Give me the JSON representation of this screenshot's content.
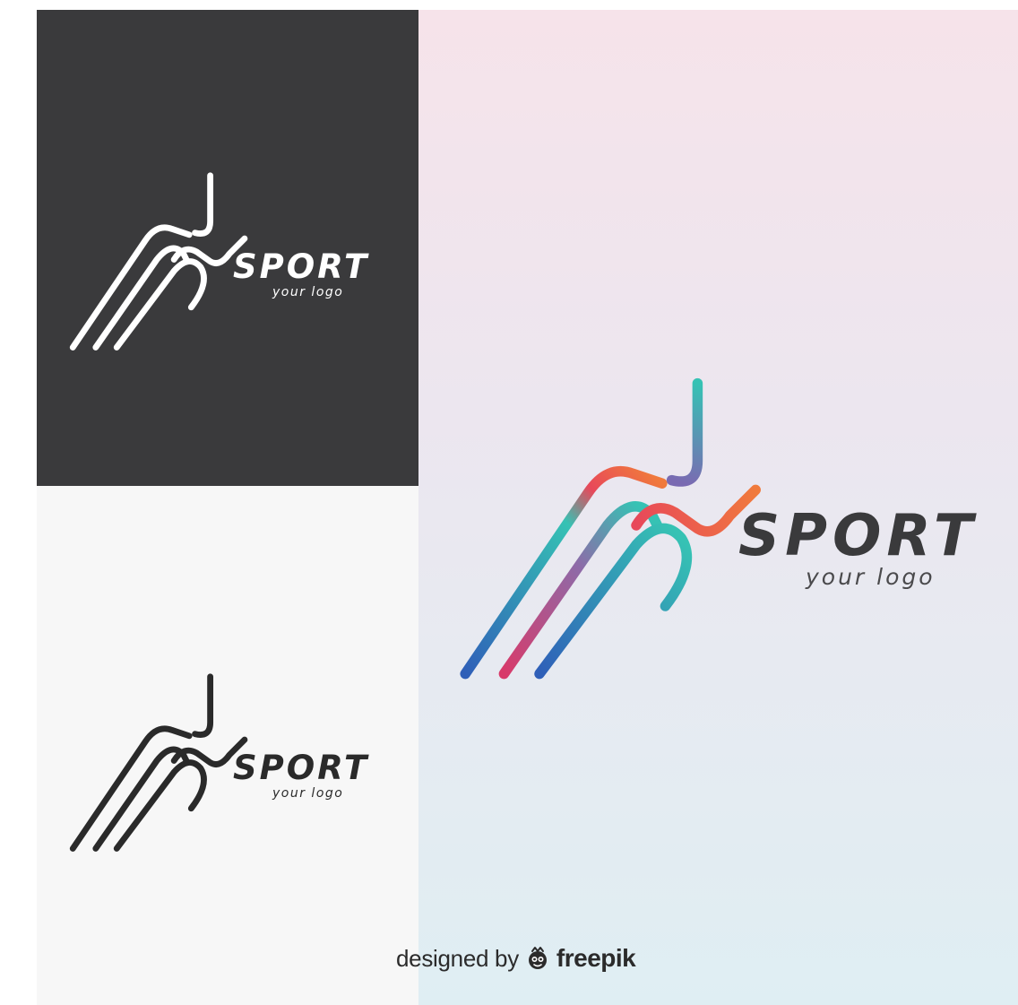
{
  "logos": [
    {
      "variant": "white-on-dark",
      "title": "SPORT",
      "tagline": "your logo",
      "color": "#ffffff"
    },
    {
      "variant": "black-on-light",
      "title": "SPORT",
      "tagline": "your logo",
      "color": "#2a2a2a"
    },
    {
      "variant": "gradient",
      "title": "SPORT",
      "tagline": "your logo",
      "color": "#3a3a3c"
    }
  ],
  "colors": {
    "dark_panel": "#3a3a3c",
    "light_panel": "#f7f7f7",
    "gradient_red": "#e8485a",
    "gradient_orange": "#f07a3c",
    "gradient_teal": "#36c2b4",
    "gradient_blue": "#2f5fb8"
  },
  "credit": {
    "prefix": "designed by",
    "brand": "freepik",
    "icon": "freepik-icon"
  }
}
